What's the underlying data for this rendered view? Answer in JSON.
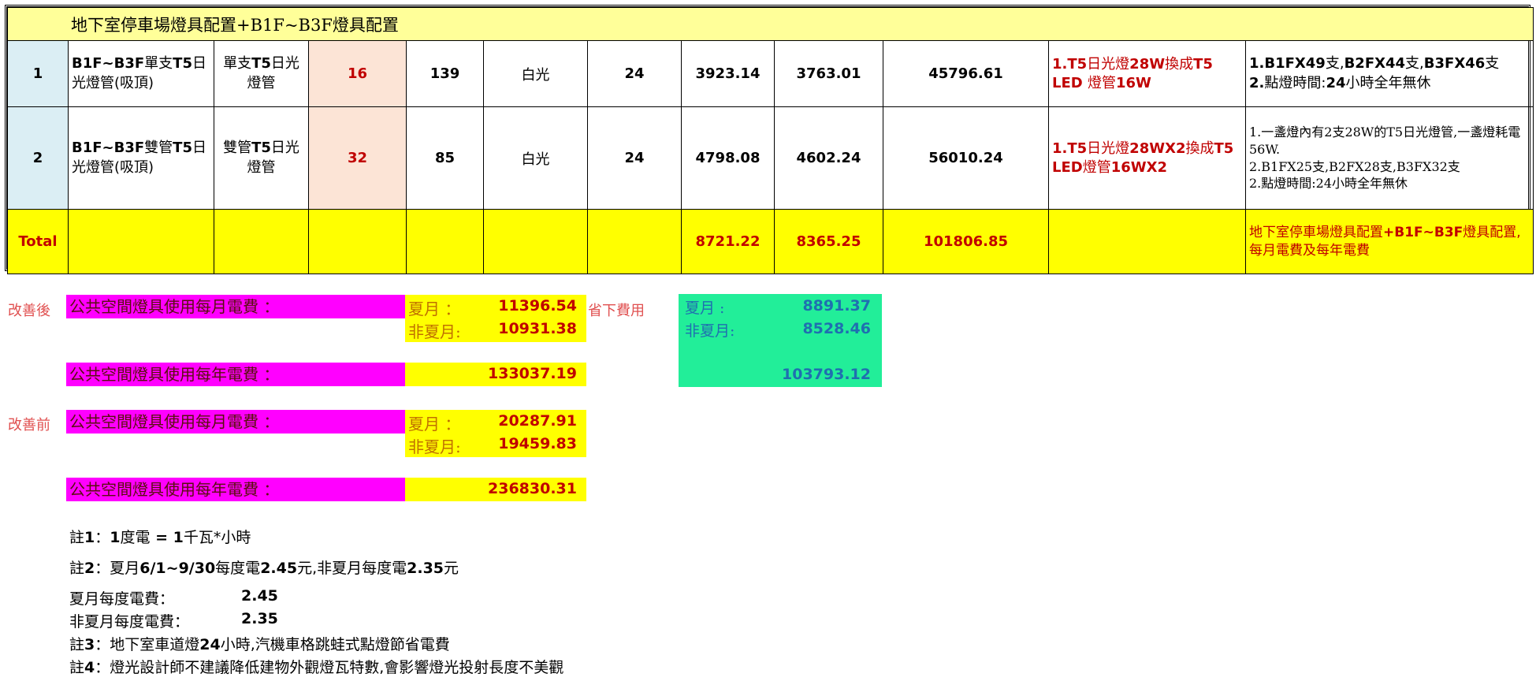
{
  "table": {
    "title": "地下室停車場燈具配置+B1F~B3F燈具配置",
    "rows": [
      {
        "no": "1",
        "location_bold": "B1F~B3F",
        "location_a": "單支",
        "location_bold2": "T5",
        "location_b": "日光燈管(吸頂)",
        "type_a": "單支",
        "type_bold": "T5",
        "type_b": "日光燈管",
        "watt": "16",
        "qty": "139",
        "color": "白光",
        "hours": "24",
        "v1": "3923.14",
        "v2": "3763.01",
        "v3": "45796.61",
        "note1_a": "1.T5",
        "note1_b": "日光燈",
        "note1_c": "28W",
        "note1_d": "換成",
        "note1_e": "T5 LED",
        "note1_f": "燈管",
        "note1_g": "16W",
        "note2_line1_a": "1.B1FX49",
        "note2_line1_b": "支,",
        "note2_line1_c": "B2FX44",
        "note2_line1_d": "支,",
        "note2_line1_e": "B3FX46",
        "note2_line1_f": "支",
        "note2_line2_a": "2.",
        "note2_line2_b": "點燈時間:",
        "note2_line2_c": "24",
        "note2_line2_d": "小時全年無休"
      },
      {
        "no": "2",
        "location_bold": "B1F~B3F",
        "location_a": "雙管",
        "location_bold2": "T5",
        "location_b": "日光燈管(吸頂)",
        "type_a": "雙管",
        "type_bold": "T5",
        "type_b": "日光燈管",
        "watt": "32",
        "qty": "85",
        "color": "白光",
        "hours": "24",
        "v1": "4798.08",
        "v2": "4602.24",
        "v3": "56010.24",
        "note1_a": "1.T5",
        "note1_b": "日光燈",
        "note1_c": "28WX2",
        "note1_d": "換成",
        "note1_e": "T5 LED",
        "note1_f": "燈管",
        "note1_g": "16WX2",
        "note2_line1": "1.一盞燈內有2支28W的T5日光燈管,一盞燈耗電56W.",
        "note2_line2": "2.B1FX25支,B2FX28支,B3FX32支",
        "note2_line3": "2.點燈時間:24小時全年無休"
      }
    ],
    "total": {
      "label": "Total",
      "v1": "8721.22",
      "v2": "8365.25",
      "v3": "101806.85",
      "note_a": "地下室停車場燈具配置",
      "note_b": "+B1F~B3F",
      "note_c": "燈具配置,每月電費及每年電費"
    }
  },
  "after": {
    "side_label": "改善後",
    "monthly_label": "公共空間燈具使用每月電費 ：",
    "summer_label": "夏月 ：",
    "summer_value": "11396.54",
    "nonsummer_label": "非夏月:",
    "nonsummer_value": "10931.38",
    "yearly_label": "公共空間燈具使用每年電費 ：",
    "yearly_value": "133037.19"
  },
  "savings": {
    "label": "省下費用",
    "summer_label": "夏月 :",
    "summer_value": "8891.37",
    "nonsummer_label": "非夏月:",
    "nonsummer_value": "8528.46",
    "yearly_value": "103793.12"
  },
  "before": {
    "side_label": "改善前",
    "monthly_label": "公共空間燈具使用每月電費 ：",
    "summer_label": "夏月 ：",
    "summer_value": "20287.91",
    "nonsummer_label": "非夏月:",
    "nonsummer_value": "19459.83",
    "yearly_label": "公共空間燈具使用每年電費 ：",
    "yearly_value": "236830.31"
  },
  "notes": {
    "n1_a": "註",
    "n1_b": "1",
    "n1_c": "：",
    "n1_d": "1",
    "n1_e": "度電",
    "n1_f": " = 1",
    "n1_g": "千瓦*小時",
    "n2_a": "註",
    "n2_b": "2",
    "n2_c": "：夏月",
    "n2_d": "6/1~9/30",
    "n2_e": "每度電",
    "n2_f": "2.45",
    "n2_g": "元,非夏月每度電",
    "n2_h": "2.35",
    "n2_i": "元",
    "summer_rate_label": "夏月每度電費：",
    "summer_rate": "2.45",
    "nonsummer_rate_label": "非夏月每度電費：",
    "nonsummer_rate": "2.35",
    "n3_a": "註",
    "n3_b": "3",
    "n3_c": "：地下室車道燈",
    "n3_d": "24",
    "n3_e": "小時,汽機車格跳蛙式點燈節省電費",
    "n4_a": "註",
    "n4_b": "4",
    "n4_c": "：燈光設計師不建議降低建物外觀燈瓦特數,會影響燈光投射長度不美觀"
  }
}
